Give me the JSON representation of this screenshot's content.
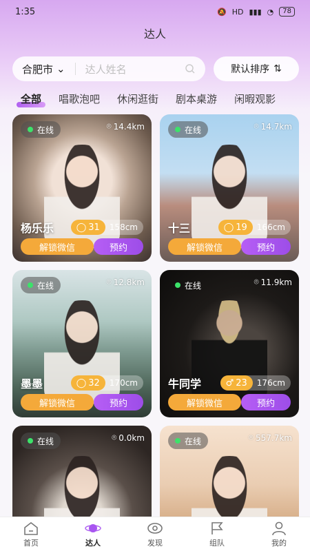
{
  "status_bar": {
    "time": "1:35",
    "signal": "HD",
    "battery": "78"
  },
  "page_title": "达人",
  "search": {
    "city": "合肥市",
    "placeholder": "达人姓名"
  },
  "sort": {
    "label": "默认排序"
  },
  "tabs": [
    {
      "label": "全部",
      "active": true
    },
    {
      "label": "唱歌泡吧"
    },
    {
      "label": "休闲逛街"
    },
    {
      "label": "剧本桌游"
    },
    {
      "label": "闲暇观影"
    }
  ],
  "cards": [
    {
      "status": "在线",
      "distance": "14.4km",
      "name": "杨乐乐",
      "count": "31",
      "height": "158cm",
      "unlock": "解锁微信",
      "book": "预约",
      "count_icon": "chat-bubble-icon"
    },
    {
      "status": "在线",
      "distance": "14.7km",
      "name": "十三",
      "count": "19",
      "height": "166cm",
      "unlock": "解锁微信",
      "book": "预约",
      "count_icon": "chat-bubble-icon"
    },
    {
      "status": "在线",
      "distance": "12.8km",
      "name": "墨墨",
      "count": "32",
      "height": "170cm",
      "unlock": "解锁微信",
      "book": "预约",
      "count_icon": "chat-bubble-icon"
    },
    {
      "status": "在线",
      "distance": "11.9km",
      "name": "牛同学",
      "count": "23",
      "height": "176cm",
      "unlock": "解锁微信",
      "book": "预约",
      "count_icon": "male-icon"
    },
    {
      "status": "在线",
      "distance": "0.0km",
      "name": "",
      "count": "",
      "height": "",
      "unlock": "",
      "book": ""
    },
    {
      "status": "在线",
      "distance": "557.7km",
      "name": "",
      "count": "",
      "height": "",
      "unlock": "",
      "book": ""
    }
  ],
  "nav": [
    {
      "label": "首页",
      "icon": "home-icon"
    },
    {
      "label": "达人",
      "icon": "planet-icon",
      "active": true
    },
    {
      "label": "发现",
      "icon": "eye-icon"
    },
    {
      "label": "组队",
      "icon": "flag-icon"
    },
    {
      "label": "我的",
      "icon": "user-icon"
    }
  ],
  "colors": {
    "accent": "#a855f0",
    "orange": "#f4a93a",
    "online": "#3ce26a"
  }
}
